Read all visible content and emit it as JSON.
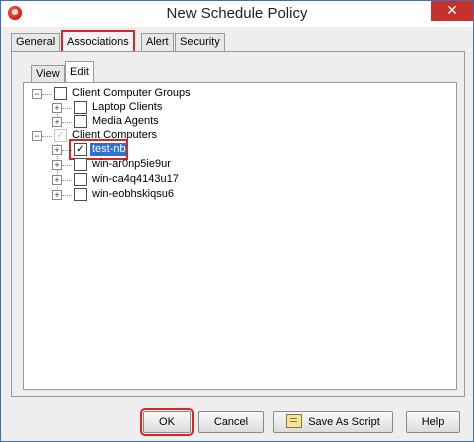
{
  "window": {
    "title": "New Schedule Policy",
    "close_label": "✕"
  },
  "tabs": [
    {
      "label": "General"
    },
    {
      "label": "Associations"
    },
    {
      "label": "Alert"
    },
    {
      "label": "Security"
    }
  ],
  "subtabs": [
    {
      "label": "View"
    },
    {
      "label": "Edit"
    }
  ],
  "tree": {
    "groups": {
      "label": "Client Computer Groups",
      "children": [
        "Laptop Clients",
        "Media Agents"
      ]
    },
    "computers": {
      "label": "Client Computers",
      "children": [
        {
          "label": "test-nb",
          "checked": true,
          "selected": true
        },
        {
          "label": "win-ar0np5ie9ur",
          "checked": false
        },
        {
          "label": "win-ca4q4143u17",
          "checked": false
        },
        {
          "label": "win-eobhskiqsu6",
          "checked": false
        }
      ]
    }
  },
  "buttons": {
    "ok": "OK",
    "cancel": "Cancel",
    "save_as_script": "Save As Script",
    "help": "Help"
  },
  "colors": {
    "highlight": "#d9252a",
    "selection": "#2f6fd6",
    "close": "#c7312b"
  }
}
